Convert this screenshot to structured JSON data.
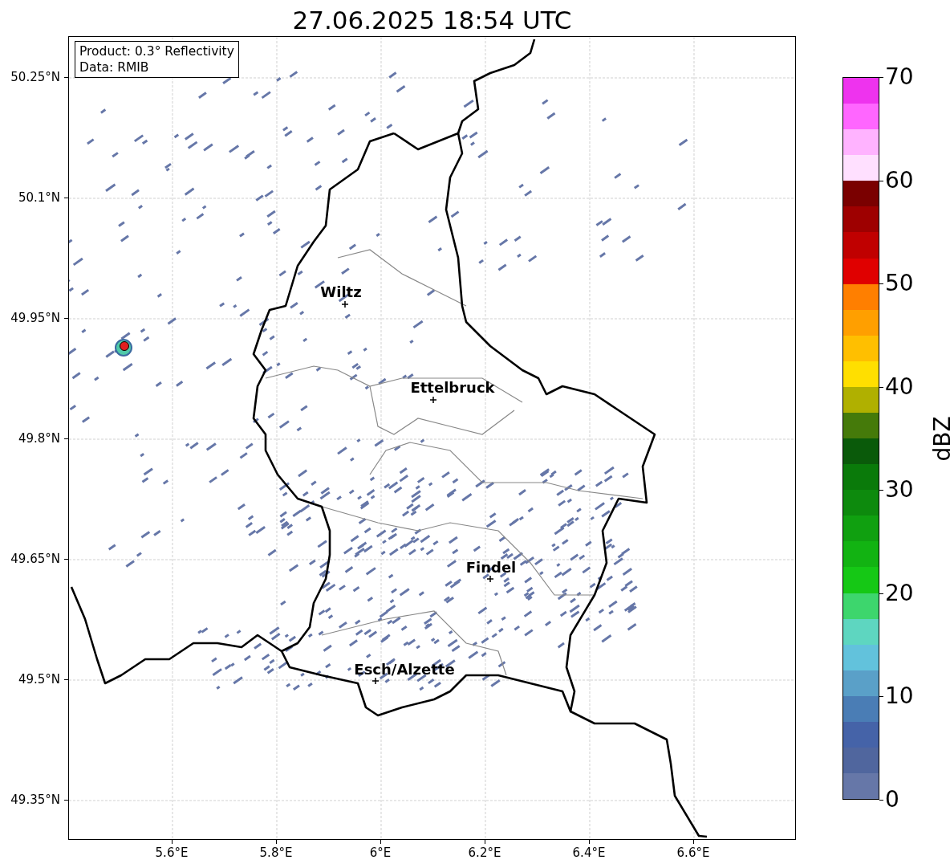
{
  "title": "27.06.2025 18:54 UTC",
  "legend": {
    "lines": [
      "Product: 0.3° Reflectivity",
      "Data: RMIB"
    ]
  },
  "map": {
    "lat_ticks": [
      "50.25°N",
      "50.1°N",
      "49.95°N",
      "49.8°N",
      "49.65°N",
      "49.5°N",
      "49.35°N"
    ],
    "lon_ticks": [
      "5.6°E",
      "5.8°E",
      "6°E",
      "6.2°E",
      "6.4°E",
      "6.6°E"
    ],
    "cities": [
      {
        "name": "Wiltz"
      },
      {
        "name": "Ettelbruck"
      },
      {
        "name": "Findel"
      },
      {
        "name": "Esch/Alzette"
      }
    ]
  },
  "colorbar": {
    "label": "dBZ",
    "ticks": [
      "70",
      "60",
      "50",
      "40",
      "30",
      "20",
      "10",
      "0"
    ],
    "bands": [
      {
        "color": "#ee33ee"
      },
      {
        "color": "#ff66ff"
      },
      {
        "color": "#ffb3ff"
      },
      {
        "color": "#ffe0ff"
      },
      {
        "color": "#7a0000"
      },
      {
        "color": "#9e0000"
      },
      {
        "color": "#c00000"
      },
      {
        "color": "#e00000"
      },
      {
        "color": "#ff7f00"
      },
      {
        "color": "#ff9f00"
      },
      {
        "color": "#ffbf00"
      },
      {
        "color": "#ffdf00"
      },
      {
        "color": "#b0b000"
      },
      {
        "color": "#457a0a"
      },
      {
        "color": "#0a5a0a"
      },
      {
        "color": "#0a7a0a"
      },
      {
        "color": "#0d8a0d"
      },
      {
        "color": "#10a010"
      },
      {
        "color": "#12b312"
      },
      {
        "color": "#15c815"
      },
      {
        "color": "#3dd66d"
      },
      {
        "color": "#5ed6c0"
      },
      {
        "color": "#62c2dc"
      },
      {
        "color": "#5aa0c8"
      },
      {
        "color": "#4a7db5"
      },
      {
        "color": "#4563a8"
      },
      {
        "color": "#50669e"
      },
      {
        "color": "#6677a8"
      }
    ]
  }
}
